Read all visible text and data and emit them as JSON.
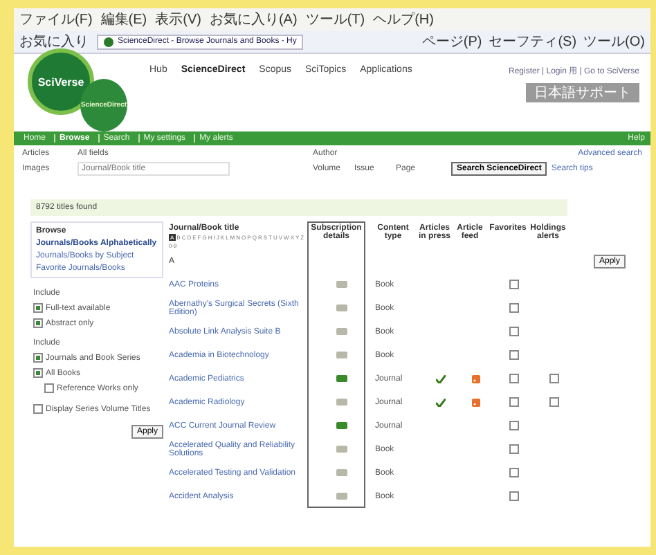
{
  "browser": {
    "menu": [
      "ファイル(F)",
      "編集(E)",
      "表示(V)",
      "お気に入り(A)",
      "ツール(T)",
      "ヘルプ(H)"
    ],
    "favorites": "お気に入り",
    "tab_title": "ScienceDirect - Browse Journals and Books - Hy",
    "toolbar": [
      "ページ(P)",
      "セーフティ(S)",
      "ツール(O)"
    ]
  },
  "header": {
    "logo": "SciVerse",
    "sublogo": "ScienceDirect",
    "nav": [
      {
        "label": "Hub",
        "selected": false
      },
      {
        "label": "ScienceDirect",
        "selected": true
      },
      {
        "label": "Scopus",
        "selected": false
      },
      {
        "label": "SciTopics",
        "selected": false
      },
      {
        "label": "Applications",
        "selected": false
      }
    ],
    "user_links": "Register | Login 用 | Go to SciVerse",
    "language_button": "日本語サポート"
  },
  "tabs": [
    {
      "label": "Home",
      "selected": false
    },
    {
      "label": "Browse",
      "selected": true
    },
    {
      "label": "Search",
      "selected": false
    },
    {
      "label": "My settings",
      "selected": false
    },
    {
      "label": "My alerts",
      "selected": false
    }
  ],
  "help": "Help",
  "search": {
    "articles_label": "Articles",
    "images_label": "Images",
    "all_fields": "All fields",
    "author": "Author",
    "title_placeholder": "Journal/Book title",
    "volume": "Volume",
    "issue": "Issue",
    "page": "Page",
    "button": "Search ScienceDirect",
    "tips": "Search tips",
    "advanced": "Advanced search"
  },
  "result_count": "8792 titles found",
  "sidebar": {
    "heading": "Browse",
    "links": [
      {
        "label": "Journals/Books Alphabetically",
        "selected": true
      },
      {
        "label": "Journals/Books by Subject",
        "selected": false
      },
      {
        "label": "Favorite Journals/Books",
        "selected": false
      }
    ],
    "groups": [
      {
        "title": "Include",
        "options": [
          {
            "label": "Full-text available",
            "checked": true
          },
          {
            "label": "Abstract only",
            "checked": true
          }
        ]
      },
      {
        "title": "Include",
        "options": [
          {
            "label": "Journals and Book Series",
            "checked": true
          },
          {
            "label": "All Books",
            "checked": true,
            "children": [
              {
                "label": "Reference Works only",
                "checked": false
              }
            ]
          }
        ]
      },
      {
        "options": [
          {
            "label": "Display Series Volume Titles",
            "checked": false
          }
        ]
      }
    ],
    "apply": "Apply"
  },
  "table": {
    "columns": [
      "Journal/Book title",
      "Subscription details",
      "Content type",
      "Articles in press",
      "Article feed",
      "Favorites",
      "Holdings alerts"
    ],
    "alphabet": [
      {
        "label": "A",
        "selected": true
      },
      {
        "label": "B",
        "selected": false
      },
      {
        "label": "C",
        "selected": false
      },
      {
        "label": "D",
        "selected": false
      },
      {
        "label": "E",
        "selected": false
      },
      {
        "label": "F",
        "selected": false
      },
      {
        "label": "G",
        "selected": false
      },
      {
        "label": "H",
        "selected": false
      },
      {
        "label": "I",
        "selected": false
      },
      {
        "label": "J",
        "selected": false
      },
      {
        "label": "K",
        "selected": false
      },
      {
        "label": "L",
        "selected": false
      },
      {
        "label": "M",
        "selected": false
      },
      {
        "label": "N",
        "selected": false
      },
      {
        "label": "O",
        "selected": false
      },
      {
        "label": "P",
        "selected": false
      },
      {
        "label": "Q",
        "selected": false
      },
      {
        "label": "R",
        "selected": false
      },
      {
        "label": "S",
        "selected": false
      },
      {
        "label": "T",
        "selected": false
      },
      {
        "label": "U",
        "selected": false
      },
      {
        "label": "V",
        "selected": false
      },
      {
        "label": "W",
        "selected": false
      },
      {
        "label": "X",
        "selected": false
      },
      {
        "label": "Y",
        "selected": false
      },
      {
        "label": "Z",
        "selected": false
      },
      {
        "label": "0-9",
        "selected": false
      }
    ],
    "section": "A",
    "apply": "Apply",
    "rows": [
      {
        "title": "AAC Proteins",
        "full_access": false,
        "type": "Book",
        "in_press": false,
        "feed": false,
        "favorite": false
      },
      {
        "title": "Abernathy's Surgical Secrets (Sixth Edition)",
        "full_access": false,
        "type": "Book",
        "in_press": false,
        "feed": false,
        "favorite": false
      },
      {
        "title": "Absolute Link Analysis Suite B",
        "full_access": false,
        "type": "Book",
        "in_press": false,
        "feed": false,
        "favorite": false
      },
      {
        "title": "Academia in Biotechnology",
        "full_access": false,
        "type": "Book",
        "in_press": false,
        "feed": false,
        "favorite": false
      },
      {
        "title": "Academic Pediatrics",
        "full_access": true,
        "type": "Journal",
        "in_press": true,
        "feed": true,
        "favorite": false,
        "holdings": {
          "checked": false
        }
      },
      {
        "title": "Academic Radiology",
        "full_access": false,
        "type": "Journal",
        "in_press": true,
        "feed": true,
        "favorite": false,
        "holdings": {
          "checked": false
        }
      },
      {
        "title": "ACC Current Journal Review",
        "full_access": true,
        "type": "Journal",
        "in_press": false,
        "feed": false,
        "favorite": false
      },
      {
        "title": "Accelerated Quality and Reliability Solutions",
        "full_access": false,
        "type": "Book",
        "in_press": false,
        "feed": false,
        "favorite": false
      },
      {
        "title": "Accelerated Testing and Validation",
        "full_access": false,
        "type": "Book",
        "in_press": false,
        "feed": false,
        "favorite": false
      },
      {
        "title": "Accident Analysis",
        "full_access": false,
        "type": "Book",
        "in_press": false,
        "feed": false,
        "favorite": false
      }
    ]
  }
}
